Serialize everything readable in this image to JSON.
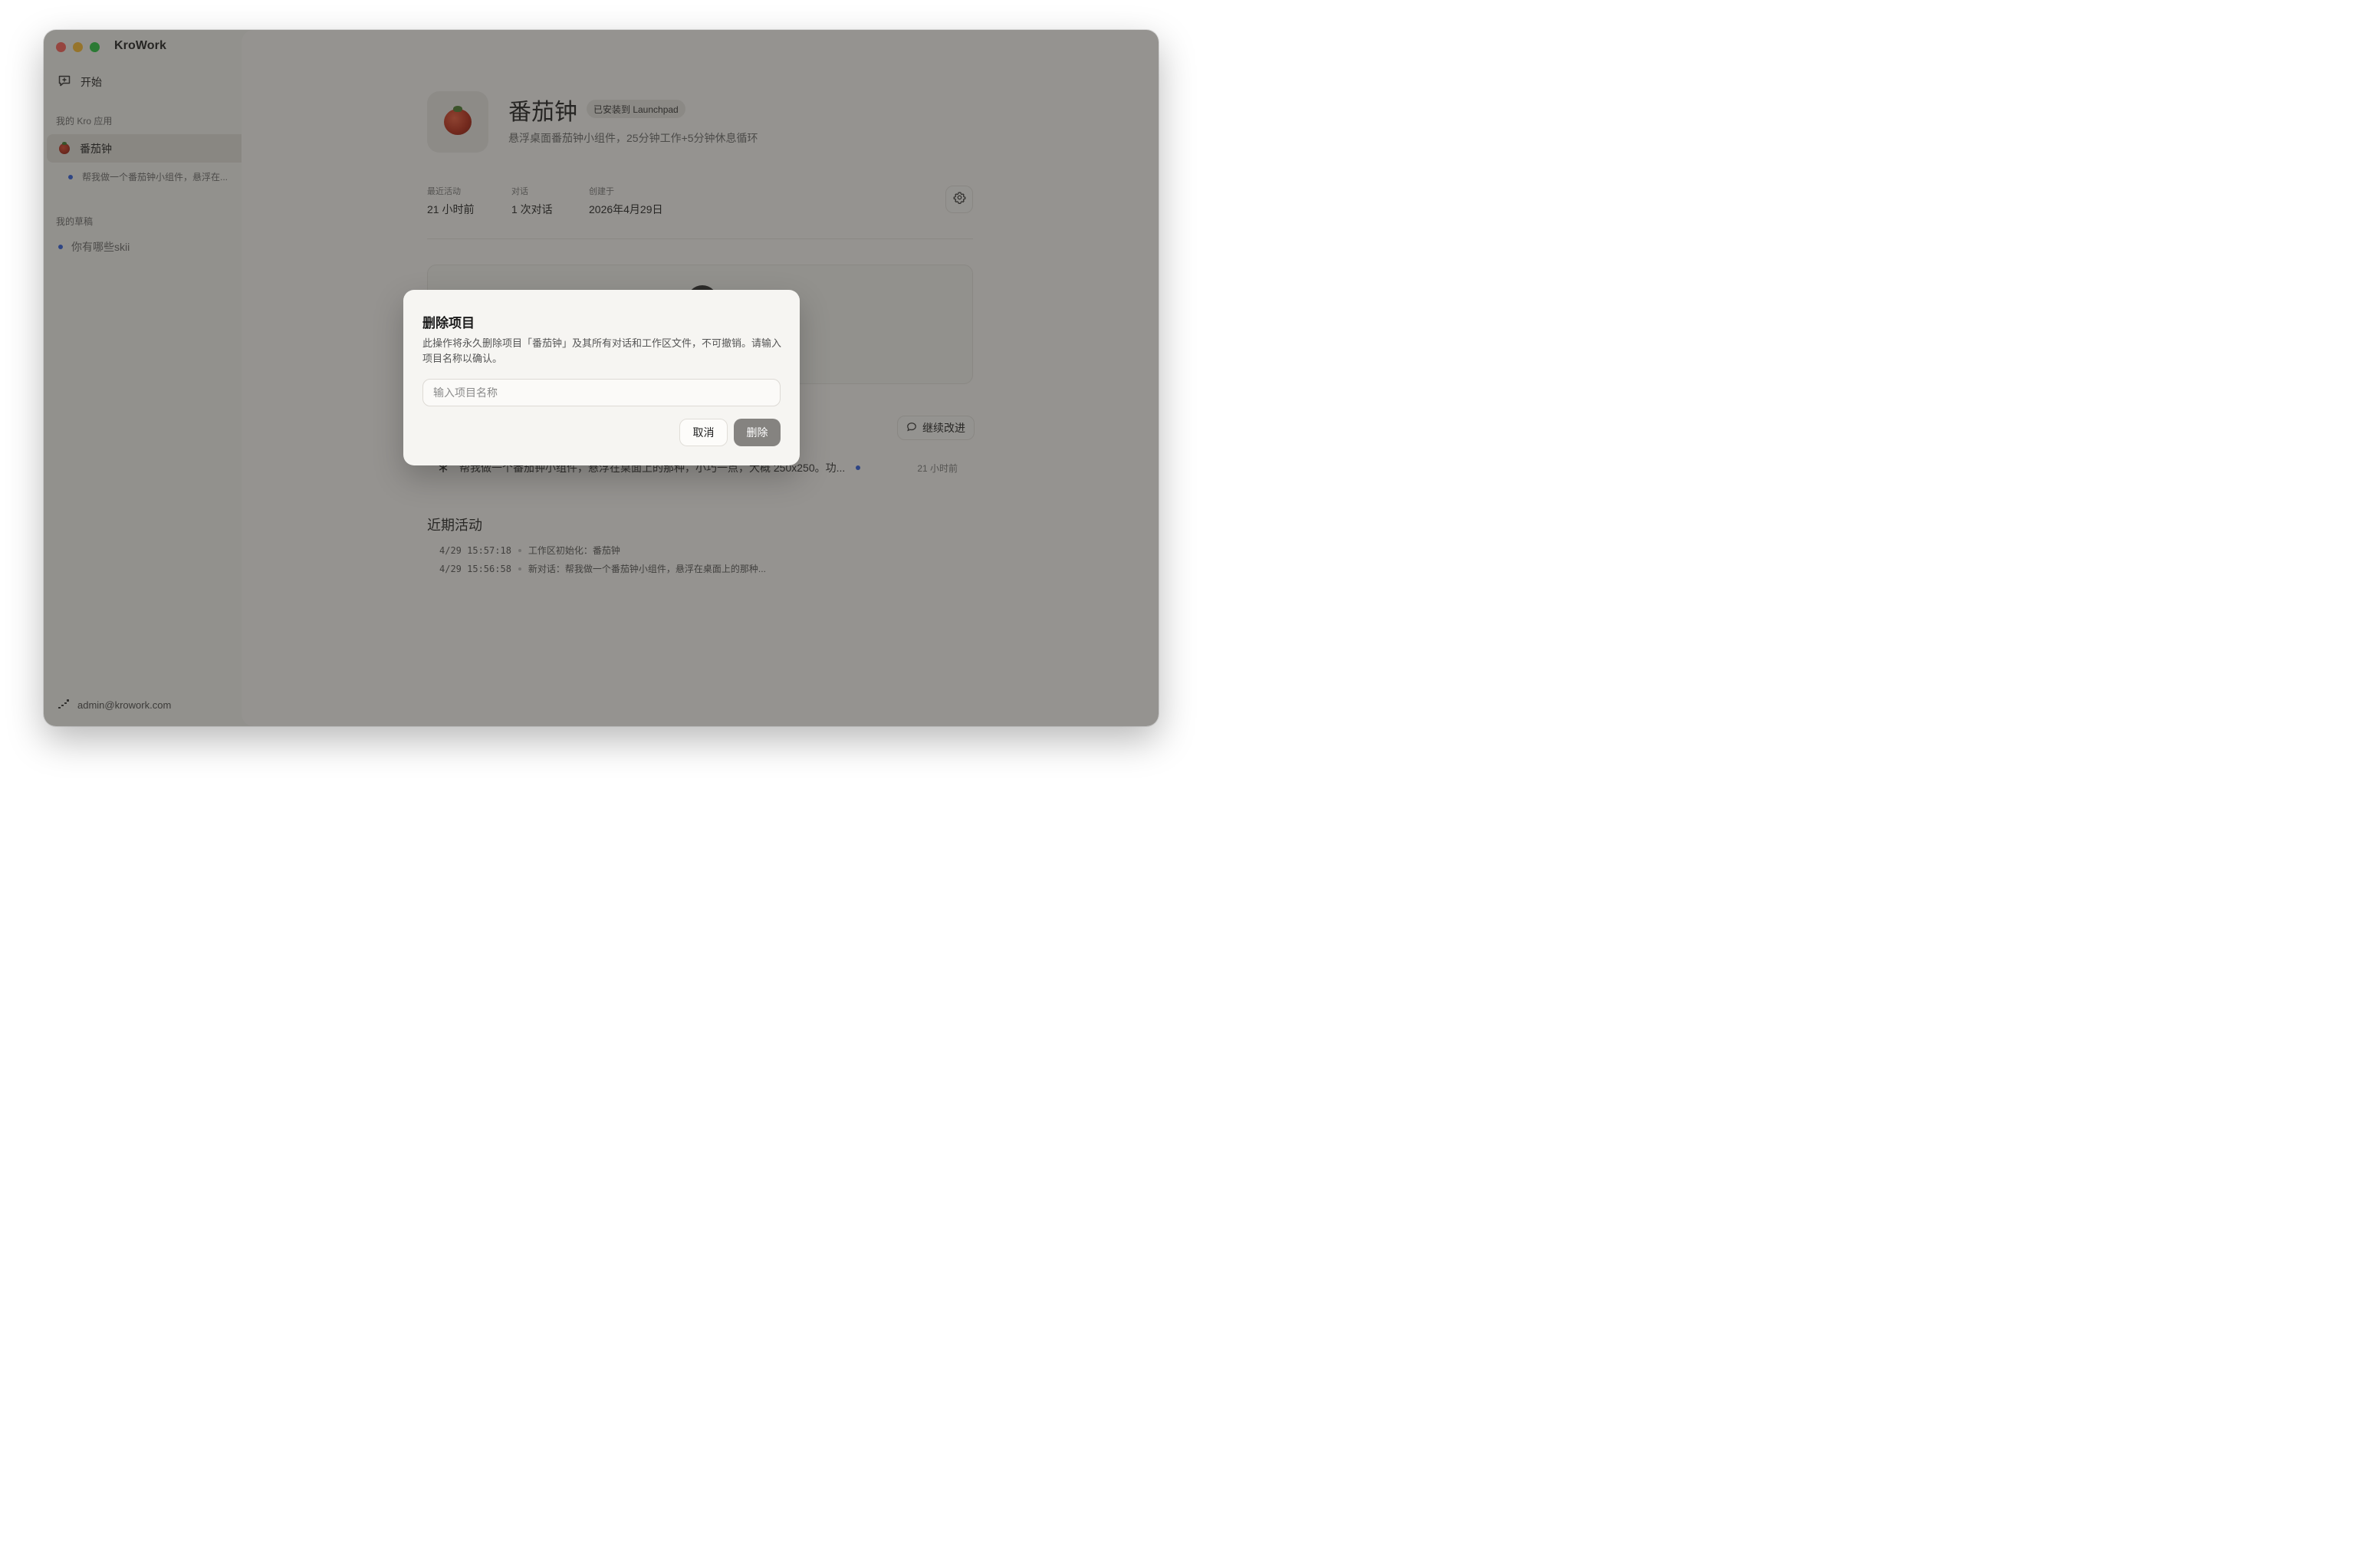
{
  "window": {
    "app_title": "KroWork"
  },
  "sidebar": {
    "start_label": "开始",
    "apps_section_label": "我的 Kro 应用",
    "project": {
      "name": "番茄钟",
      "conversation": "帮我做一个番茄钟小组件，悬浮在..."
    },
    "drafts_section_label": "我的草稿",
    "draft": {
      "name": "你有哪些skii"
    },
    "user_email": "admin@krowork.com"
  },
  "project": {
    "title": "番茄钟",
    "badge": "已安装到 Launchpad",
    "description": "悬浮桌面番茄钟小组件，25分钟工作+5分钟休息循环",
    "meta": [
      {
        "label": "最近活动",
        "value": "21 小时前"
      },
      {
        "label": "对话",
        "value": "1 次对话"
      },
      {
        "label": "创建于",
        "value": "2026年4月29日"
      }
    ],
    "continue_label": "继续改进",
    "conversation": {
      "text": "帮我做一个番茄钟小组件，悬浮在桌面上的那种，小巧一点，大概 250x250。功...",
      "time": "21 小时前"
    },
    "recent_title": "近期活动",
    "activity": [
      {
        "time": "4/29 15:57:18",
        "text": "工作区初始化：番茄钟"
      },
      {
        "time": "4/29 15:56:58",
        "text": "新对话：帮我做一个番茄钟小组件，悬浮在桌面上的那种..."
      }
    ]
  },
  "dialog": {
    "title": "删除项目",
    "body": "此操作将永久删除项目「番茄钟」及其所有对话和工作区文件，不可撤销。请输入项目名称以确认。",
    "input_value": "",
    "input_placeholder": "输入项目名称",
    "cancel_label": "取消",
    "delete_label": "删除"
  },
  "colors": {
    "traffic_red": "#ff5f57",
    "traffic_yellow": "#febc2e",
    "traffic_green": "#28c840",
    "accent_dot": "#2f5fe0",
    "delete_button": "#858380"
  },
  "icons": {
    "start": "new-chat-icon",
    "project": "tomato-icon",
    "settings": "gear-icon",
    "continue": "chat-bubble-icon",
    "conversation": "sparkle-icon",
    "user": "signal-icon"
  }
}
